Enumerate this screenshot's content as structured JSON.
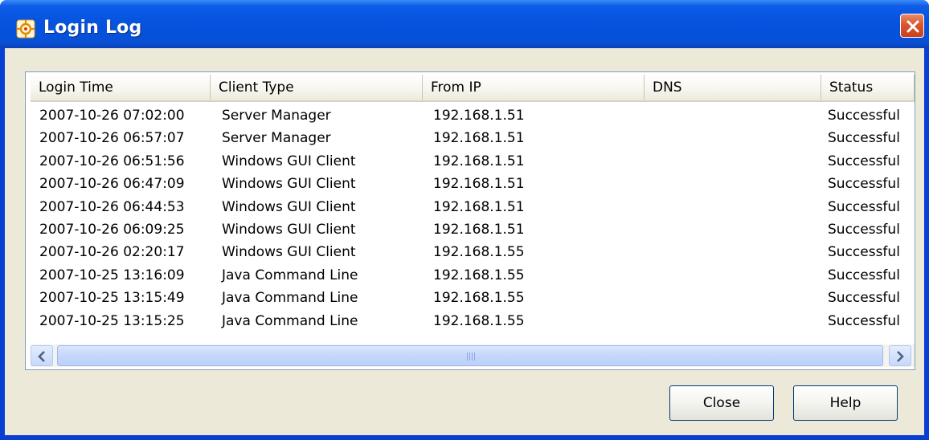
{
  "window": {
    "title": "Login Log"
  },
  "table": {
    "columns": [
      "Login Time",
      "Client Type",
      "From IP",
      "DNS",
      "Status"
    ],
    "rows": [
      [
        "2007-10-26 07:02:00",
        "Server Manager",
        "192.168.1.51",
        "",
        "Successful"
      ],
      [
        "2007-10-26 06:57:07",
        "Server Manager",
        "192.168.1.51",
        "",
        "Successful"
      ],
      [
        "2007-10-26 06:51:56",
        "Windows GUI Client",
        "192.168.1.51",
        "",
        "Successful"
      ],
      [
        "2007-10-26 06:47:09",
        "Windows GUI Client",
        "192.168.1.51",
        "",
        "Successful"
      ],
      [
        "2007-10-26 06:44:53",
        "Windows GUI Client",
        "192.168.1.51",
        "",
        "Successful"
      ],
      [
        "2007-10-26 06:09:25",
        "Windows GUI Client",
        "192.168.1.51",
        "",
        "Successful"
      ],
      [
        "2007-10-26 02:20:17",
        "Windows GUI Client",
        "192.168.1.55",
        "",
        "Successful"
      ],
      [
        "2007-10-25 13:16:09",
        "Java Command Line",
        "192.168.1.55",
        "",
        "Successful"
      ],
      [
        "2007-10-25 13:15:49",
        "Java Command Line",
        "192.168.1.55",
        "",
        "Successful"
      ],
      [
        "2007-10-25 13:15:25",
        "Java Command Line",
        "192.168.1.55",
        "",
        "Successful"
      ]
    ]
  },
  "buttons": {
    "close": "Close",
    "help": "Help"
  },
  "icons": {
    "app": "app-logo-icon",
    "window_close": "close-icon",
    "scroll_left": "chevron-left-icon",
    "scroll_right": "chevron-right-icon"
  },
  "colors": {
    "titlebar": "#0452dc",
    "close_button": "#d9572f",
    "dialog_bg": "#ece9d8"
  }
}
